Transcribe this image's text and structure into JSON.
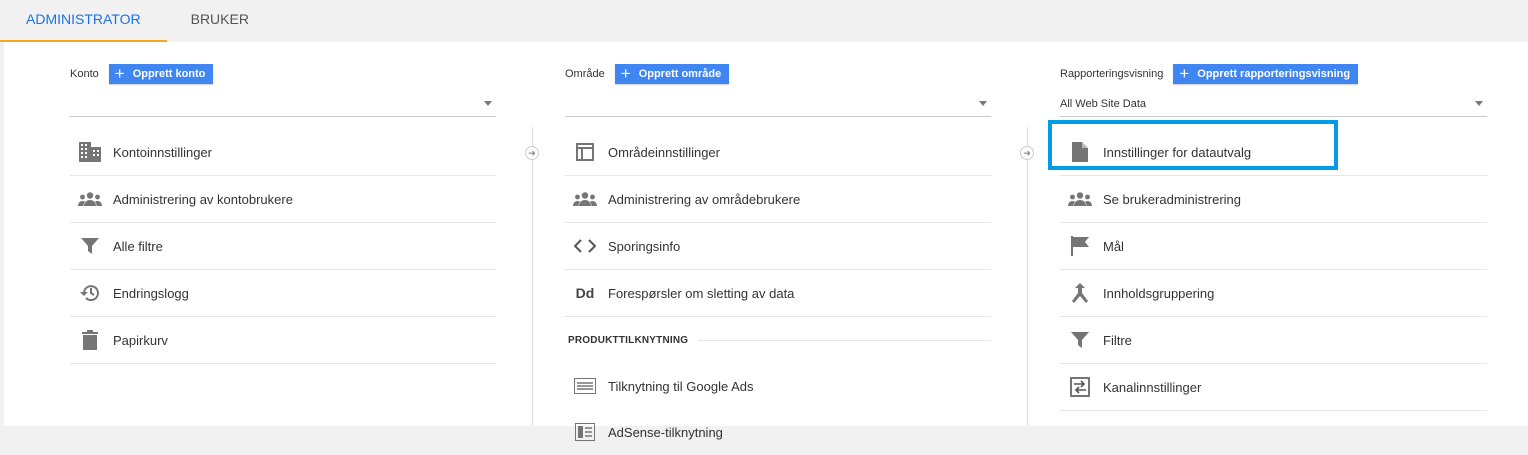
{
  "tabs": [
    {
      "label": "ADMINISTRATOR"
    },
    {
      "label": "BRUKER"
    }
  ],
  "columns": {
    "account": {
      "label": "Konto",
      "button": "Opprett konto",
      "selected": "",
      "items": [
        {
          "label": "Kontoinnstillinger",
          "icon": "building-icon"
        },
        {
          "label": "Administrering av kontobrukere",
          "icon": "people-icon"
        },
        {
          "label": "Alle filtre",
          "icon": "filter-icon"
        },
        {
          "label": "Endringslogg",
          "icon": "history-icon"
        },
        {
          "label": "Papirkurv",
          "icon": "trash-icon"
        }
      ]
    },
    "property": {
      "label": "Område",
      "button": "Opprett område",
      "selected": "",
      "items": [
        {
          "label": "Områdeinnstillinger",
          "icon": "window-icon"
        },
        {
          "label": "Administrering av områdebrukere",
          "icon": "people-icon"
        },
        {
          "label": "Sporingsinfo",
          "icon": "code-icon"
        },
        {
          "label": "Forespørsler om sletting av data",
          "icon": "dd-icon"
        }
      ],
      "section_heading": "PRODUKTTILKNYTNING",
      "section_items": [
        {
          "label": "Tilknytning til Google Ads",
          "icon": "ads-icon"
        },
        {
          "label": "AdSense-tilknytning",
          "icon": "adsense-icon"
        }
      ]
    },
    "view": {
      "label": "Rapporteringsvisning",
      "button": "Opprett rapporteringsvisning",
      "selected": "All Web Site Data",
      "items": [
        {
          "label": "Innstillinger for datautvalg",
          "icon": "document-icon"
        },
        {
          "label": "Se brukeradministrering",
          "icon": "people-icon"
        },
        {
          "label": "Mål",
          "icon": "flag-icon"
        },
        {
          "label": "Innholdsgruppering",
          "icon": "merge-icon"
        },
        {
          "label": "Filtre",
          "icon": "filter-icon"
        },
        {
          "label": "Kanalinnstillinger",
          "icon": "channel-icon"
        }
      ]
    }
  },
  "colors": {
    "accent": "#1a73e8",
    "button": "#3f86f2",
    "tab_underline": "#f6a623",
    "highlight": "#039be5",
    "icon": "#757575"
  }
}
